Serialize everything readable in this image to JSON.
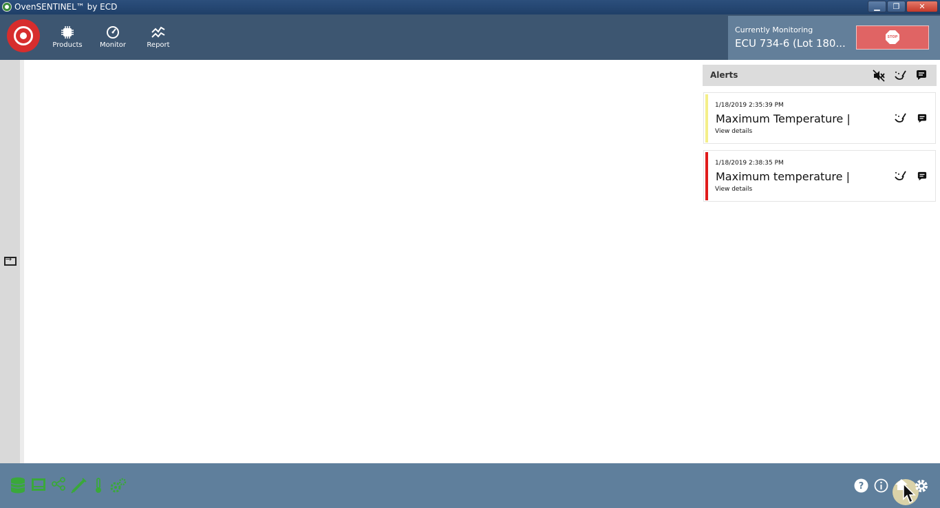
{
  "window": {
    "title": "OvenSENTINEL™ by ECD",
    "close_glyph": "✕"
  },
  "nav": {
    "items": [
      {
        "label": "Products",
        "icon": "chip-icon"
      },
      {
        "label": "Monitor",
        "icon": "gauge-icon"
      },
      {
        "label": "Report",
        "icon": "trend-icon"
      }
    ]
  },
  "monitoring": {
    "label": "Currently Monitoring",
    "value": "ECU 734-6 (Lot 180...",
    "stop_label": "STOP"
  },
  "alerts": {
    "title": "Alerts",
    "items": [
      {
        "timestamp": "1/18/2019 2:35:39 PM",
        "message": "Maximum Temperature |",
        "link": "View details",
        "severity_color": "#f4ef8a"
      },
      {
        "timestamp": "1/18/2019 2:38:35 PM",
        "message": "Maximum temperature |",
        "link": "View details",
        "severity_color": "#e01b1b"
      }
    ]
  },
  "colors": {
    "toolbar": "#3d5671",
    "monitor_panel": "#637f9a",
    "stop_button": "#e06464",
    "bottom_bar": "#5f7f9c",
    "status_icons_green": "#3aa83a"
  }
}
